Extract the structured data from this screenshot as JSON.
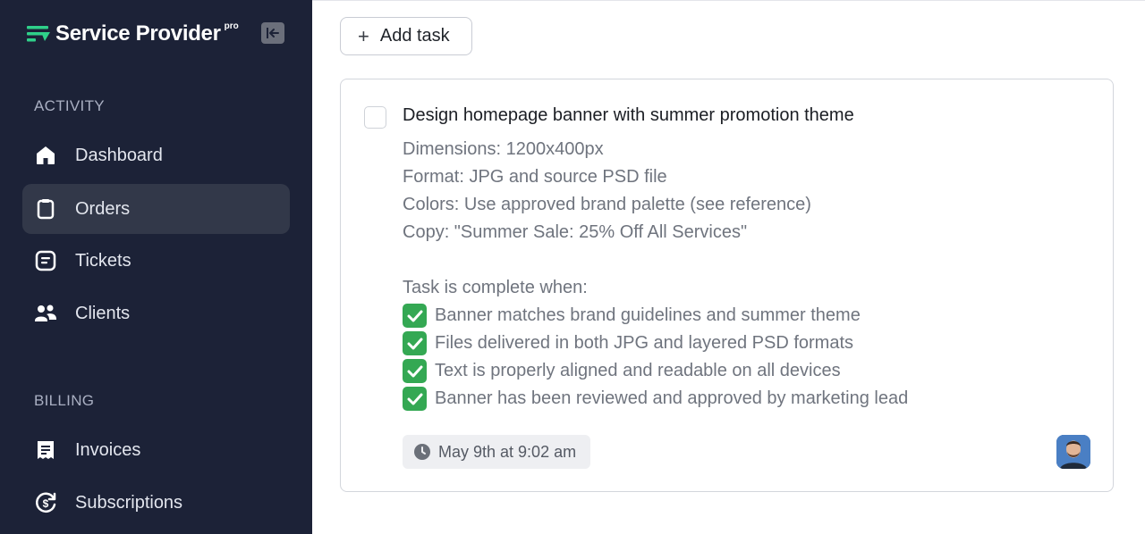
{
  "brand": {
    "name": "Service Provider",
    "badge": "pro",
    "logo_icon": "service-provider-logo",
    "collapse_icon": "collapse-sidebar-icon"
  },
  "sidebar": {
    "sections": [
      {
        "label": "ACTIVITY",
        "items": [
          {
            "label": "Dashboard",
            "icon": "home-icon",
            "active": false
          },
          {
            "label": "Orders",
            "icon": "clipboard-icon",
            "active": true
          },
          {
            "label": "Tickets",
            "icon": "ticket-icon",
            "active": false
          },
          {
            "label": "Clients",
            "icon": "users-icon",
            "active": false
          }
        ]
      },
      {
        "label": "BILLING",
        "items": [
          {
            "label": "Invoices",
            "icon": "receipt-icon",
            "active": false
          },
          {
            "label": "Subscriptions",
            "icon": "subscription-icon",
            "active": false
          }
        ]
      }
    ]
  },
  "main": {
    "add_task_label": "Add task",
    "task": {
      "title": "Design homepage banner with summer promotion theme",
      "completed": false,
      "details": [
        "Dimensions: 1200x400px",
        "Format: JPG and source PSD file",
        "Colors: Use approved brand palette (see reference)",
        "Copy: \"Summer Sale: 25% Off All Services\""
      ],
      "criteria_heading": "Task is complete when:",
      "criteria": [
        "Banner matches brand guidelines and summer theme",
        "Files delivered in both JPG and layered PSD formats",
        "Text is properly aligned and readable on all devices",
        "Banner has been reviewed and approved by marketing lead"
      ],
      "date": "May 9th at 9:02 am"
    }
  },
  "colors": {
    "sidebar_bg": "#1c2237",
    "sidebar_active": "#323849",
    "check_green": "#34a853"
  }
}
